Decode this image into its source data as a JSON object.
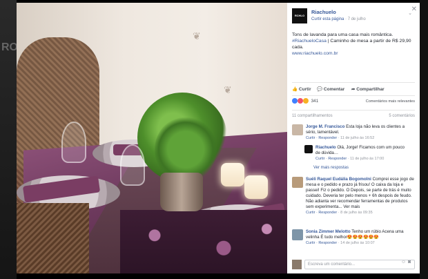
{
  "background": {
    "ghost_text": "RO"
  },
  "panel": {
    "close_icon": "close-icon",
    "page_name": "Riachuelo",
    "page_logo_text": "RCHLO",
    "curtir_page": "Curtir esta página",
    "post_date": "7 de julho",
    "post_text_1": "Tons de lavanda para uma casa mais romântica.",
    "post_tag": "#RiachueloCasa",
    "post_text_2": "| Caminho de mesa a partir de R$ 29,90 cada.",
    "post_link": "www.riachuelo.com.br",
    "actions": {
      "like": "Curtir",
      "comment": "Comentar",
      "share": "Compartilhar"
    },
    "reaction_count": "341",
    "relevance": "Comentários mais relevantes",
    "shares": "11 compartilhamentos",
    "comments_count": "5 comentários",
    "comments": [
      {
        "name": "Jorge M. Francisco",
        "text": "Esta loja não leva os clientes a sério, lamentável.",
        "meta_reply": "Curtir · Responder",
        "time": "11 de julho às 16:52"
      },
      {
        "name": "Riachuelo",
        "text": "Olá, Jorge! Ficamos com um pouco de dúvida…",
        "meta_reply": "Curtir · Responder",
        "time": "11 de julho às 17:00"
      },
      {
        "name": "Suéli Raquel Eudália Bogomolni",
        "text": "Comprei esse jogo de mesa e o pedido e prazo já frisou! O caixa da loja e passei! Fiz o pedido. O Depois, se parte de trás é muito cuidado. Deveria ter pelo menos + 6h despois de feudo. Não adianta ver recomendar ferramentas de produtos sem experimenta... Ver mais",
        "meta_reply": "Curtir · Responder",
        "time": "8 de julho às 09:35"
      },
      {
        "name": "Sonia Zimmer Melotto",
        "text": "Tenho um rúbio Acena uma velinha É tudo melhor😍😍😍😍😍😍",
        "meta_reply": "Curtir · Responder",
        "time": "14 de julho às 10:07"
      }
    ],
    "more_replies": "Ver mais respostas",
    "write_placeholder": "Escreva um comentário..."
  }
}
